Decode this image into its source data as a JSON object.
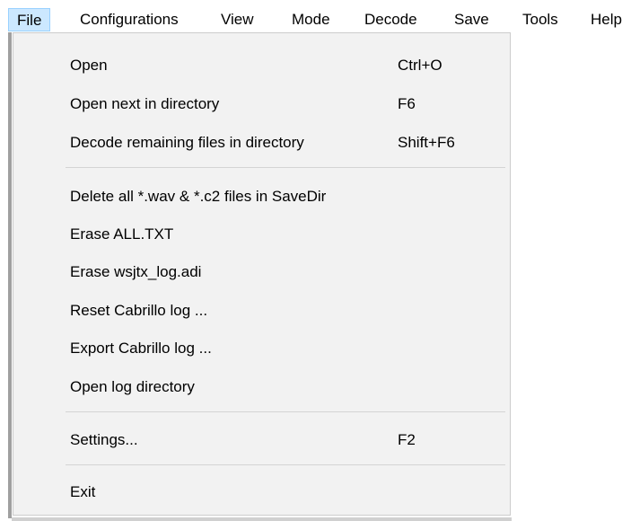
{
  "menubar": {
    "items": [
      {
        "label": "File",
        "active": true
      },
      {
        "label": "Configurations"
      },
      {
        "label": "View"
      },
      {
        "label": "Mode"
      },
      {
        "label": "Decode"
      },
      {
        "label": "Save"
      },
      {
        "label": "Tools"
      },
      {
        "label": "Help"
      }
    ]
  },
  "file_menu": {
    "items": [
      {
        "label": "Open",
        "shortcut": "Ctrl+O"
      },
      {
        "label": "Open next in directory",
        "shortcut": "F6"
      },
      {
        "label": "Decode remaining files in directory",
        "shortcut": "Shift+F6"
      },
      {
        "label": "Delete all *.wav & *.c2 files in SaveDir"
      },
      {
        "label": "Erase ALL.TXT"
      },
      {
        "label": "Erase wsjtx_log.adi"
      },
      {
        "label": "Reset Cabrillo log ..."
      },
      {
        "label": "Export Cabrillo log ..."
      },
      {
        "label": "Open log directory"
      },
      {
        "label": "Settings...",
        "shortcut": "F2"
      },
      {
        "label": "Exit"
      }
    ]
  },
  "colors": {
    "active_menu_bg": "#cce8ff",
    "active_menu_border": "#99d1ff",
    "menu_bg": "#f2f2f2",
    "separator": "#d4d4d4"
  }
}
